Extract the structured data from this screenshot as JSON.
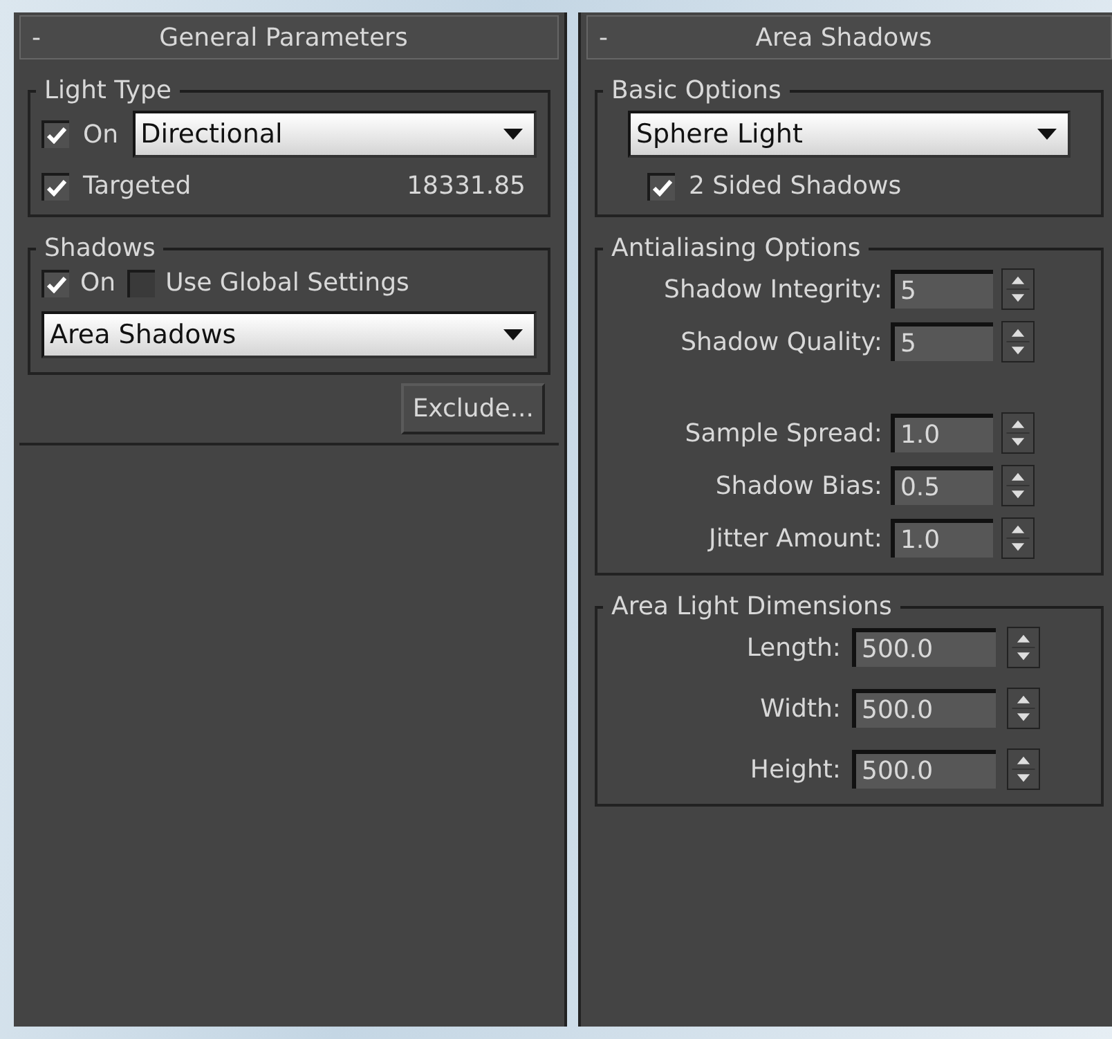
{
  "rollouts": [
    {
      "collapse_symbol": "-",
      "title": "General Parameters",
      "items": [
        {
          "kind": "group",
          "title": "Light Type",
          "rows": [
            {
              "kind": "checkbox_dropdown",
              "checkbox": {
                "label": "On",
                "checked": true
              },
              "dropdown": {
                "value": "Directional"
              }
            },
            {
              "kind": "checkbox_value",
              "checkbox": {
                "label": "Targeted",
                "checked": true
              },
              "value": "18331.85"
            }
          ]
        },
        {
          "kind": "group",
          "title": "Shadows",
          "rows": [
            {
              "kind": "checkboxes",
              "items": [
                {
                  "label": "On",
                  "checked": true
                },
                {
                  "label": "Use Global Settings",
                  "checked": false
                }
              ]
            },
            {
              "kind": "dropdown",
              "dropdown": {
                "value": "Area Shadows"
              }
            }
          ]
        },
        {
          "kind": "button",
          "label": "Exclude..."
        }
      ]
    },
    {
      "collapse_symbol": "-",
      "title": "Area Shadows",
      "items": [
        {
          "kind": "group",
          "title": "Basic Options",
          "rows": [
            {
              "kind": "dropdown",
              "dropdown": {
                "value": "Sphere Light"
              }
            },
            {
              "kind": "checkbox",
              "checkbox": {
                "label": "2 Sided Shadows",
                "checked": true
              }
            }
          ]
        },
        {
          "kind": "group",
          "title": "Antialiasing Options",
          "rows": [
            {
              "kind": "spinner",
              "label": "Shadow Integrity:",
              "value": "5"
            },
            {
              "kind": "spinner",
              "label": "Shadow Quality:",
              "value": "5"
            },
            {
              "kind": "spacer"
            },
            {
              "kind": "spinner",
              "label": "Sample Spread:",
              "value": "1.0"
            },
            {
              "kind": "spinner",
              "label": "Shadow Bias:",
              "value": "0.5"
            },
            {
              "kind": "spinner",
              "label": "Jitter Amount:",
              "value": "1.0"
            }
          ]
        },
        {
          "kind": "group",
          "title": "Area Light Dimensions",
          "rows": [
            {
              "kind": "spinner",
              "label": "Length:",
              "value": "500.0"
            },
            {
              "kind": "spinner",
              "label": "Width:",
              "value": "500.0"
            },
            {
              "kind": "spinner",
              "label": "Height:",
              "value": "500.0"
            }
          ]
        }
      ]
    }
  ]
}
